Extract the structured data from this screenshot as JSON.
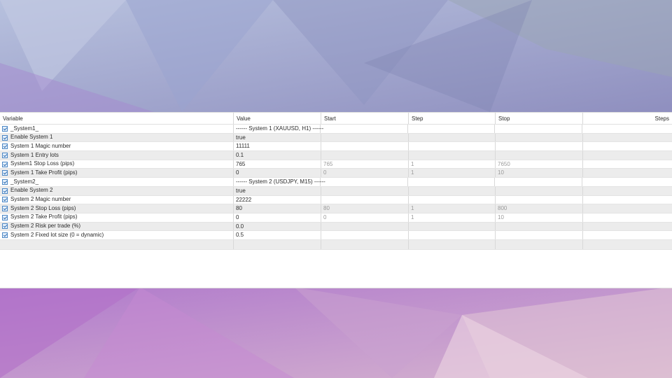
{
  "columns": {
    "variable": "Variable",
    "value": "Value",
    "start": "Start",
    "step": "Step",
    "stop": "Stop",
    "steps": "Steps"
  },
  "rows": [
    {
      "variable": "_System1_",
      "value": "------ System 1 (XAUUSD, H1) ------",
      "start": "",
      "step": "",
      "stop": "",
      "separator": true
    },
    {
      "variable": "Enable System 1",
      "value": "true",
      "start": "",
      "step": "",
      "stop": ""
    },
    {
      "variable": "System 1 Magic number",
      "value": "11111",
      "start": "",
      "step": "",
      "stop": ""
    },
    {
      "variable": "System 1 Entry lots",
      "value": "0.1",
      "start": "",
      "step": "",
      "stop": ""
    },
    {
      "variable": "System1 Stop Loss (pips)",
      "value": "765",
      "start": "765",
      "step": "1",
      "stop": "7650"
    },
    {
      "variable": "System 1 Take Profit (pips)",
      "value": "0",
      "start": "0",
      "step": "1",
      "stop": "10"
    },
    {
      "variable": "_System2_",
      "value": "------ System 2 (USDJPY, M15) ------",
      "start": "",
      "step": "",
      "stop": "",
      "separator": true
    },
    {
      "variable": "Enable System 2",
      "value": "true",
      "start": "",
      "step": "",
      "stop": ""
    },
    {
      "variable": "System 2 Magic number",
      "value": "22222",
      "start": "",
      "step": "",
      "stop": ""
    },
    {
      "variable": "System 2 Stop Loss (pips)",
      "value": "80",
      "start": "80",
      "step": "1",
      "stop": "800"
    },
    {
      "variable": "System 2 Take Profit (pips)",
      "value": "0",
      "start": "0",
      "step": "1",
      "stop": "10"
    },
    {
      "variable": "System 2 Risk per trade (%)",
      "value": "0.0",
      "start": "",
      "step": "",
      "stop": ""
    },
    {
      "variable": "System 2 Fixed lot size (0 = dynamic)",
      "value": "0.5",
      "start": "",
      "step": "",
      "stop": ""
    }
  ],
  "colors": {
    "accent": "#4a86c5",
    "row_alt": "#ececec",
    "muted_text": "#9a9a9a"
  }
}
